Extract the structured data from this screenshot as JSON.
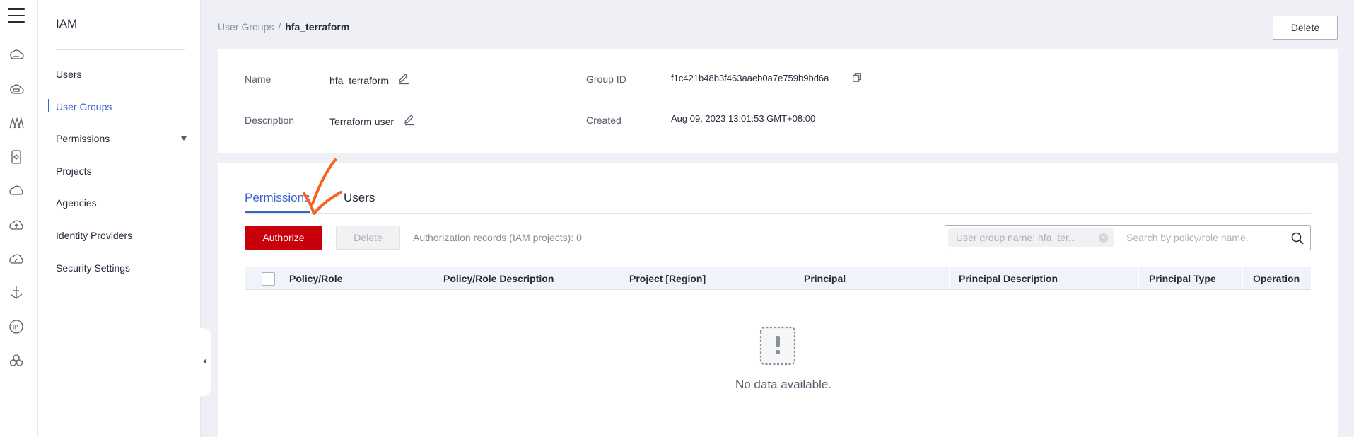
{
  "rail": {
    "icons": [
      "hamburger-menu-icon",
      "cloud-server-icon",
      "cloud-storage-icon",
      "network-icon",
      "document-icon",
      "cloud-icon",
      "cloud-upload-icon",
      "cloud-speed-icon",
      "anchor-icon",
      "ip-icon",
      "cluster-icon"
    ]
  },
  "sidebar": {
    "title": "IAM",
    "items": [
      {
        "label": "Users"
      },
      {
        "label": "User Groups"
      },
      {
        "label": "Permissions"
      },
      {
        "label": "Projects"
      },
      {
        "label": "Agencies"
      },
      {
        "label": "Identity Providers"
      },
      {
        "label": "Security Settings"
      }
    ],
    "active_item": "User Groups"
  },
  "breadcrumb": {
    "parent": "User Groups",
    "separator": "/",
    "current": "hfa_terraform"
  },
  "header": {
    "delete_label": "Delete"
  },
  "info": {
    "name_label": "Name",
    "name_value": "hfa_terraform",
    "description_label": "Description",
    "description_value": "Terraform user",
    "group_id_label": "Group ID",
    "group_id_value": "f1c421b48b3f463aaeb0a7e759b9bd6a",
    "created_label": "Created",
    "created_value": "Aug 09, 2023 13:01:53 GMT+08:00"
  },
  "tabs": [
    {
      "label": "Permissions",
      "active": true
    },
    {
      "label": "Users",
      "active": false
    }
  ],
  "toolbar": {
    "authorize_label": "Authorize",
    "delete_label": "Delete",
    "records_text": "Authorization records (IAM projects): 0"
  },
  "search": {
    "filter_tag": "User group name: hfa_ter...",
    "placeholder": "Search by policy/role name."
  },
  "table": {
    "columns": [
      "Policy/Role",
      "Policy/Role Description",
      "Project [Region]",
      "Principal",
      "Principal Description",
      "Principal Type",
      "Operation"
    ],
    "rows": [],
    "empty_text": "No data available."
  },
  "colors": {
    "accent": "#3b65c8",
    "primary_button": "#c7000b",
    "annotation": "#f26522"
  }
}
